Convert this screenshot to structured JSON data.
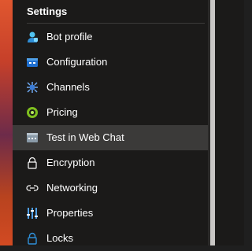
{
  "section": {
    "title": "Settings"
  },
  "items": [
    {
      "label": "Bot profile",
      "icon": "bot-profile-icon"
    },
    {
      "label": "Configuration",
      "icon": "configuration-icon"
    },
    {
      "label": "Channels",
      "icon": "channels-icon"
    },
    {
      "label": "Pricing",
      "icon": "pricing-icon"
    },
    {
      "label": "Test in Web Chat",
      "icon": "web-chat-icon",
      "selected": true
    },
    {
      "label": "Encryption",
      "icon": "lock-icon"
    },
    {
      "label": "Networking",
      "icon": "networking-icon"
    },
    {
      "label": "Properties",
      "icon": "properties-icon"
    },
    {
      "label": "Locks",
      "icon": "locks-icon"
    }
  ],
  "colors": {
    "panel_bg": "#1b1a19",
    "selected_bg": "#3b3a39",
    "text": "#ffffff",
    "accent_blue": "#50a0e8",
    "accent_green": "#9bd93b",
    "splitter": "#c8c6c4"
  }
}
